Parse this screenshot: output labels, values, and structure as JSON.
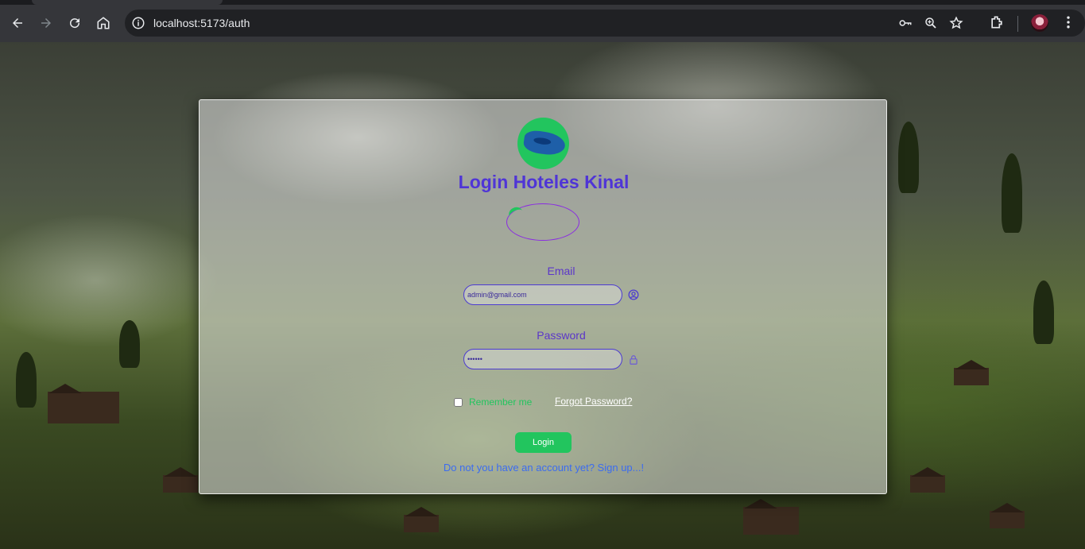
{
  "browser": {
    "url": "localhost:5173/auth",
    "colors": {
      "chrome": "#35363a",
      "omnibox": "#202124"
    }
  },
  "login": {
    "title": "Login Hoteles Kinal",
    "email_label": "Email",
    "email_value": "admin@gmail.com",
    "password_label": "Password",
    "password_value": "••••••",
    "remember_label": "Remember me",
    "forgot_label": "Forgot Password?",
    "login_button": "Login",
    "signup_link": "Do not you have an account yet? Sign up...!"
  },
  "icons": [
    "back-icon",
    "forward-icon",
    "reload-icon",
    "home-icon",
    "site-info-icon",
    "key-icon",
    "zoom-icon",
    "star-icon",
    "extensions-icon",
    "menu-icon",
    "user-icon",
    "lock-icon"
  ],
  "theme": {
    "title_color": "#4f35d6",
    "accent_green": "#22c55e",
    "link_color": "#3b6cf0"
  }
}
